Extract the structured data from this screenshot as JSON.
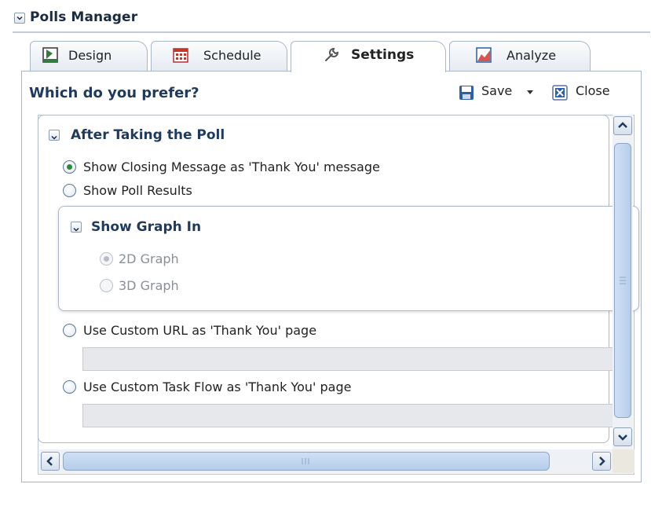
{
  "window": {
    "title": "Polls Manager"
  },
  "tabs": [
    {
      "label": "Design",
      "icon": "design-icon",
      "active": false
    },
    {
      "label": "Schedule",
      "icon": "calendar-icon",
      "active": false
    },
    {
      "label": "Settings",
      "icon": "wrench-icon",
      "active": true
    },
    {
      "label": "Analyze",
      "icon": "chart-icon",
      "active": false
    }
  ],
  "panel": {
    "title": "Which do you prefer?",
    "save_label": "Save",
    "close_label": "Close"
  },
  "after_poll": {
    "title": "After Taking the Poll",
    "options": [
      {
        "label": "Show Closing Message as 'Thank You' message",
        "checked": true
      },
      {
        "label": "Show Poll Results",
        "checked": false
      }
    ],
    "graph": {
      "title": "Show Graph In",
      "options": [
        {
          "label": "2D Graph",
          "checked": true,
          "disabled": true
        },
        {
          "label": "3D Graph",
          "checked": false,
          "disabled": true
        }
      ]
    },
    "custom_url_label": "Use Custom URL as 'Thank You' page",
    "custom_url_value": "",
    "custom_taskflow_label": "Use Custom Task Flow as 'Thank You' page",
    "custom_taskflow_value": ""
  },
  "colors": {
    "accent": "#1f3a5c",
    "selected_radio": "#2e8a3a",
    "border": "#a9b7c9"
  }
}
